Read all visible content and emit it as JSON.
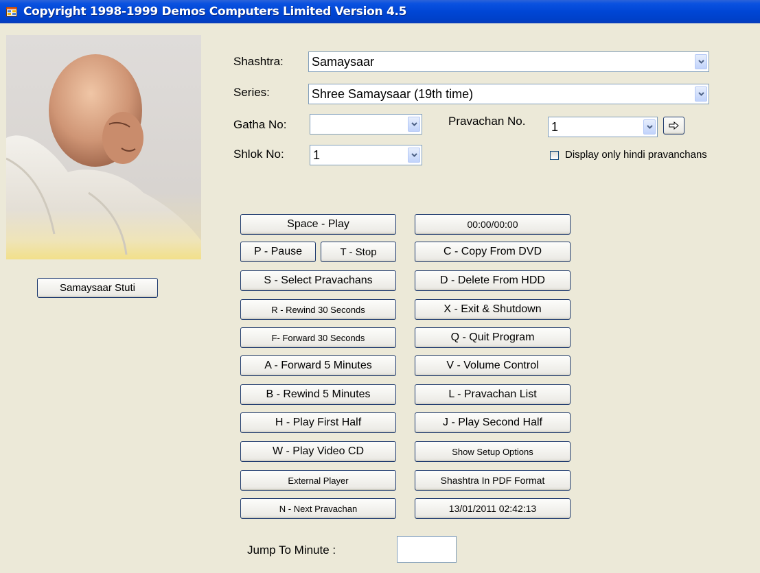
{
  "window": {
    "title": "Copyright 1998-1999 Demos Computers Limited Version 4.5",
    "icon": "app-window-icon"
  },
  "portrait": {
    "icon": "portrait-photo"
  },
  "stuti_button": "Samaysaar Stuti",
  "form": {
    "shashtra_label": "Shashtra:",
    "shashtra_value": "Samaysaar",
    "series_label": "Series:",
    "series_value": "Shree Samaysaar (19th time)",
    "gatha_label": "Gatha No:",
    "gatha_value": "",
    "pravachan_label": "Pravachan No.",
    "pravachan_value": "1",
    "go_icon": "arrow-right-icon",
    "shlok_label": "Shlok No:",
    "shlok_value": "1",
    "hindi_checkbox_label": "Display only hindi pravanchans",
    "hindi_checked": false
  },
  "buttons_left": {
    "play": "Space - Play",
    "pause": "P - Pause",
    "stop": "T - Stop",
    "select": "S - Select Pravachans",
    "rewind30": "R - Rewind 30 Seconds",
    "forward30": "F- Forward 30 Seconds",
    "forward5": "A - Forward 5 Minutes",
    "rewind5": "B - Rewind 5 Minutes",
    "first_half": "H - Play First Half",
    "video_cd": "W - Play Video CD",
    "external": "External Player",
    "next": "N - Next Pravachan"
  },
  "buttons_right": {
    "time": "00:00/00:00",
    "copy_dvd": "C - Copy From DVD",
    "delete_hdd": "D - Delete From HDD",
    "exit_shutdown": "X - Exit & Shutdown",
    "quit": "Q - Quit Program",
    "volume": "V - Volume Control",
    "list": "L - Pravachan List",
    "second_half": "J - Play Second Half",
    "setup": "Show Setup Options",
    "pdf": "Shashtra In PDF Format",
    "datetime": "13/01/2011 02:42:13"
  },
  "jump": {
    "label": "Jump To Minute :",
    "value": ""
  },
  "colors": {
    "titlebar": "#0046d5",
    "background": "#ece9d8",
    "button_border": "#1e3a6e",
    "input_border": "#7f9db9"
  }
}
